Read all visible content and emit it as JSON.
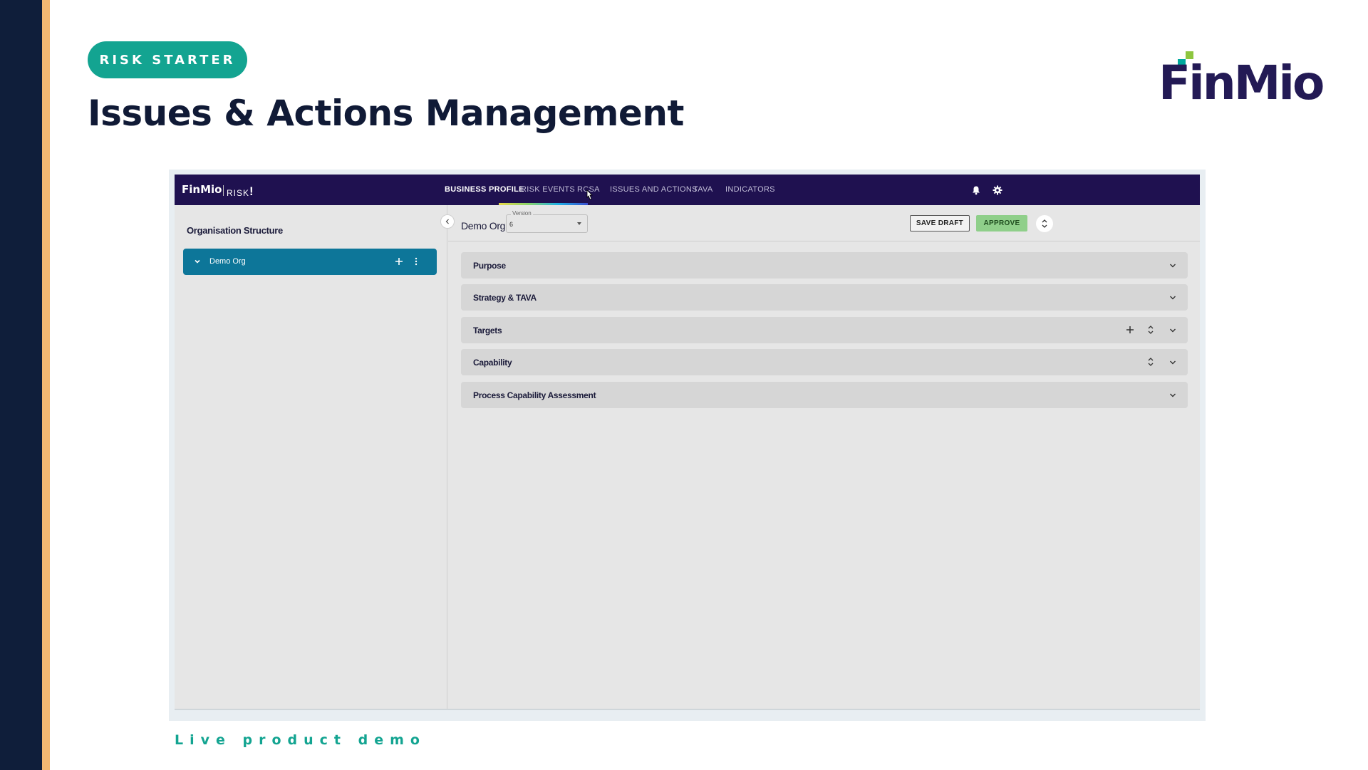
{
  "slide": {
    "badge": "RISK STARTER",
    "title": "Issues & Actions Management",
    "logo_text": "FinMio",
    "caption": "Live product demo"
  },
  "app": {
    "brand": "FinMio",
    "product": "RISK",
    "product_mark": "!",
    "nav_tabs": [
      {
        "label": "BUSINESS PROFILE",
        "active": true
      },
      {
        "label": "RISK EVENTS",
        "active": false
      },
      {
        "label": "RCSA",
        "active": false
      },
      {
        "label": "ISSUES AND ACTIONS",
        "active": false
      },
      {
        "label": "TAVA",
        "active": false
      },
      {
        "label": "INDICATORS",
        "active": false
      }
    ],
    "nav_icons": [
      "bell-icon",
      "gear-icon"
    ],
    "sidebar": {
      "title": "Organisation Structure",
      "tree": [
        {
          "label": "Demo Org",
          "expanded": true
        }
      ]
    },
    "main": {
      "org_name": "Demo Org",
      "version_label": "Version",
      "version_value": "6",
      "save_label": "SAVE DRAFT",
      "approve_label": "APPROVE",
      "sections": [
        {
          "title": "Purpose",
          "add": false,
          "sort": false
        },
        {
          "title": "Strategy & TAVA",
          "add": false,
          "sort": false
        },
        {
          "title": "Targets",
          "add": true,
          "sort": true
        },
        {
          "title": "Capability",
          "add": false,
          "sort": true
        },
        {
          "title": "Process Capability Assessment",
          "add": false,
          "sort": false
        }
      ]
    }
  },
  "colors": {
    "sidebar_stripe": "#0f1e3a",
    "accent_stripe": "#f3b872",
    "badge": "#13a491",
    "nav_bg": "#1f1150",
    "tree_selected": "#0d7699",
    "approve": "#8fcf8a"
  }
}
